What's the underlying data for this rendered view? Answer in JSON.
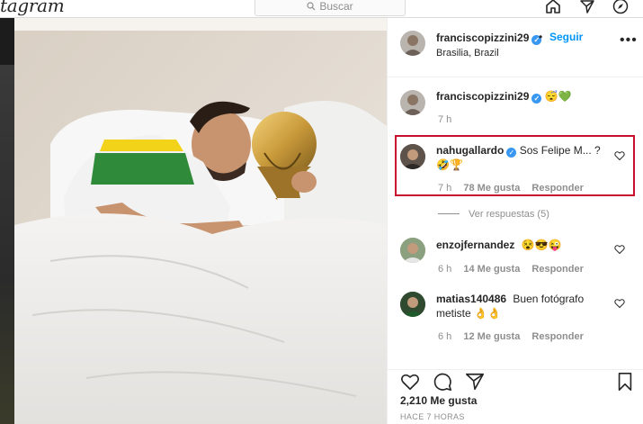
{
  "nav": {
    "logo_text": "tagram",
    "search_placeholder": "Buscar"
  },
  "post": {
    "username": "franciscopizzini29",
    "follow_label": "Seguir",
    "dot": "•",
    "location": "Brasilia, Brazil",
    "more_label": "•••"
  },
  "caption": {
    "username": "franciscopizzini29",
    "emoji": "😴💚",
    "time": "7 h"
  },
  "comments": [
    {
      "username": "nahugallardo",
      "text": "Sos Felipe M... ?",
      "emoji": "🤣🏆",
      "time": "7 h",
      "likes": "78 Me gusta",
      "reply": "Responder"
    },
    {
      "username": "enzojfernandez",
      "text": "",
      "emoji": "😵😎😜",
      "time": "6 h",
      "likes": "14 Me gusta",
      "reply": "Responder"
    },
    {
      "username": "matias140486",
      "text": "Buen fotógrafo",
      "text2": "metiste",
      "emoji": "👌👌",
      "time": "6 h",
      "likes": "12 Me gusta",
      "reply": "Responder"
    }
  ],
  "view_replies": "Ver respuestas (5)",
  "footer": {
    "likes": "2,210 Me gusta",
    "time_ago": "HACE 7 HORAS"
  },
  "colors": {
    "verified": "#3897f0",
    "follow": "#0095f6",
    "highlight": "#c8102e"
  },
  "icons": [
    "home-icon",
    "explore-icon",
    "compass-icon",
    "search-icon",
    "heart-icon",
    "comment-icon",
    "share-icon",
    "bookmark-icon",
    "more-icon"
  ]
}
